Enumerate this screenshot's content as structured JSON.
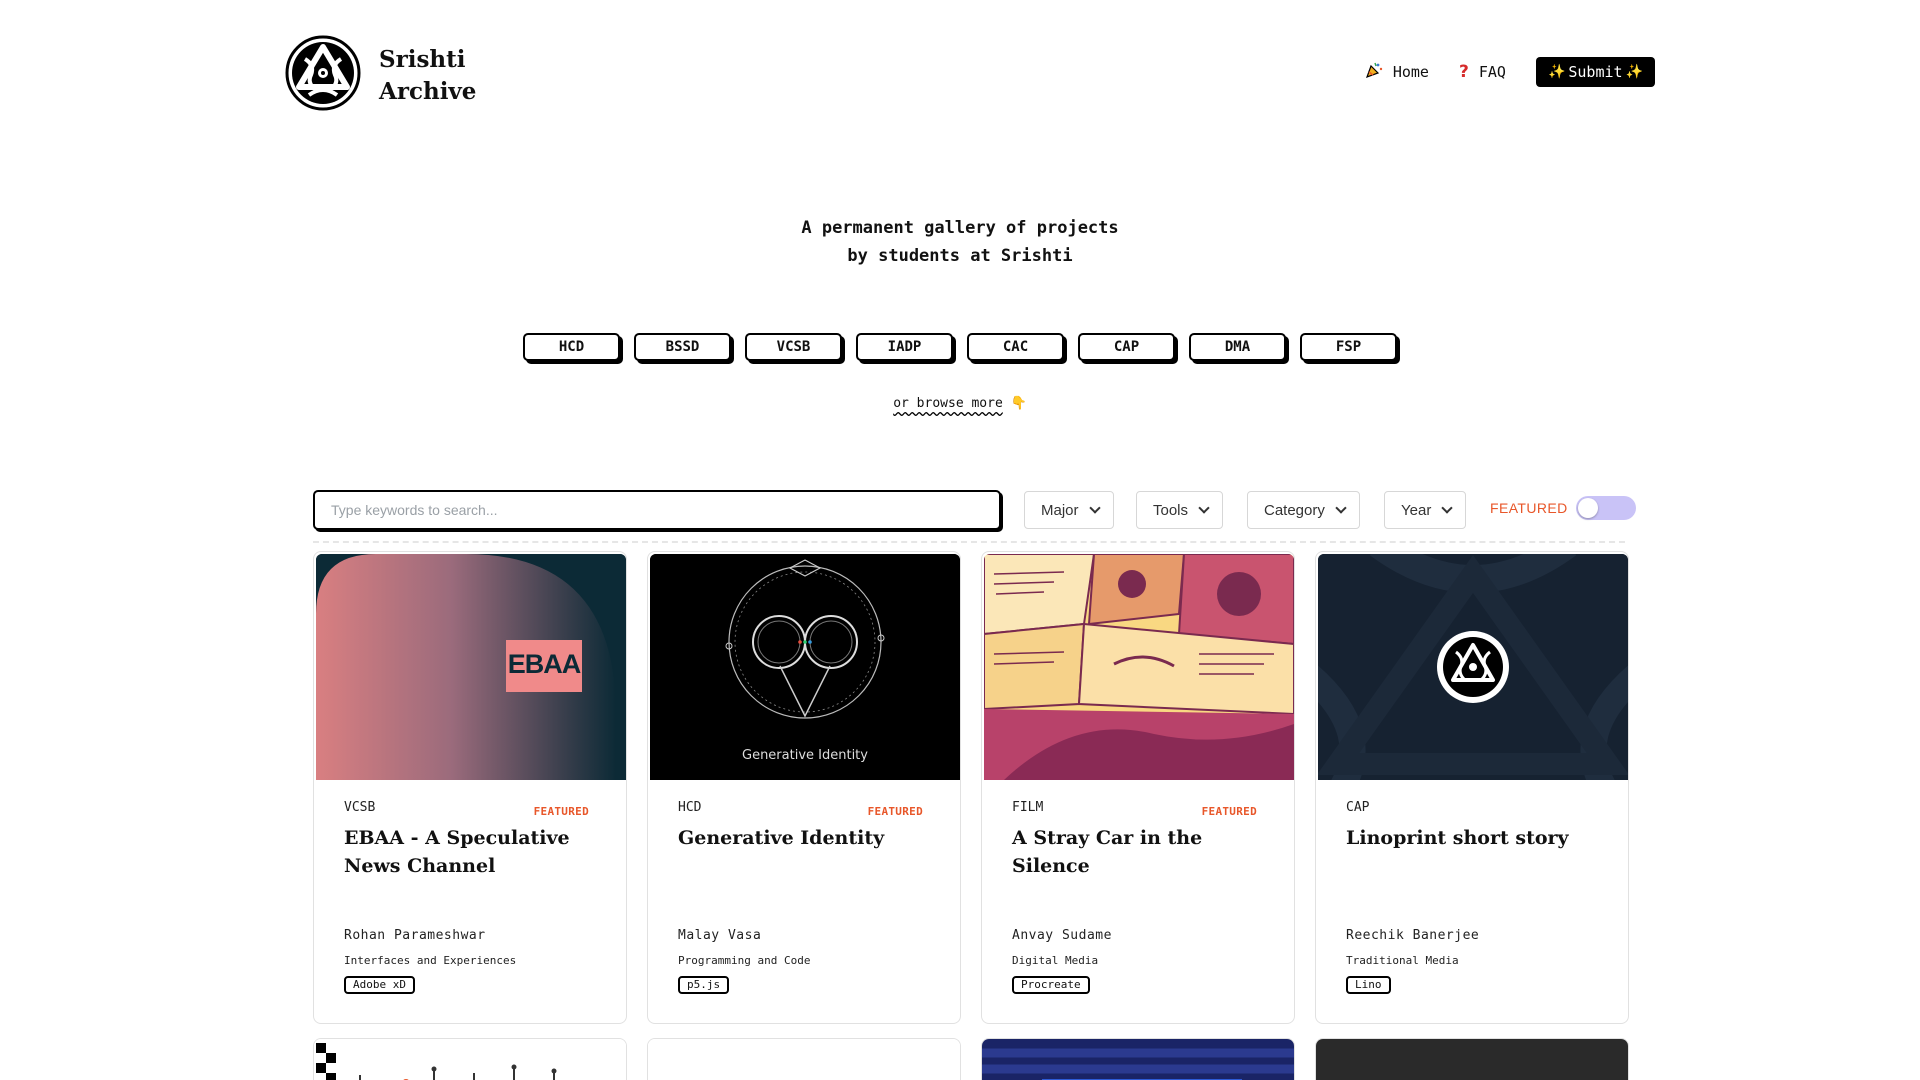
{
  "header": {
    "brand_line1": "Srishti",
    "brand_line2": "Archive",
    "nav": {
      "home_label": "Home",
      "home_icon": "party-horn-icon",
      "faq_label": "FAQ",
      "faq_icon": "question-mark-icon",
      "submit_label": "Submit",
      "submit_icon": "sparkles-icon"
    }
  },
  "hero": {
    "tagline_line1": "A permanent gallery of projects",
    "tagline_line2": "by students at Srishti",
    "majors": [
      "HCD",
      "BSSD",
      "VCSB",
      "IADP",
      "CAC",
      "CAP",
      "DMA",
      "FSP"
    ],
    "browse_more": "or browse more",
    "browse_more_icon": "pointing-down-hand-icon"
  },
  "filters": {
    "search_placeholder": "Type keywords to search...",
    "major_label": "Major",
    "tools_label": "Tools",
    "category_label": "Category",
    "year_label": "Year",
    "featured_label": "FEATURED",
    "featured_on": false
  },
  "cards": [
    {
      "major": "VCSB",
      "featured": "FEATURED",
      "title": "EBAA - A Speculative News Channel",
      "author": "Rohan Parameshwar",
      "category": "Interfaces and Experiences",
      "tool": "Adobe xD",
      "image_text": "EBAA"
    },
    {
      "major": "HCD",
      "featured": "FEATURED",
      "title": "Generative Identity",
      "author": "Malay Vasa",
      "category": "Programming and Code",
      "tool": "p5.js",
      "image_text": "Generative Identity"
    },
    {
      "major": "FILM",
      "featured": "FEATURED",
      "title": "A Stray Car in the Silence",
      "author": "Anvay Sudame",
      "category": "Digital Media",
      "tool": "Procreate",
      "image_text": ""
    },
    {
      "major": "CAP",
      "featured": "",
      "title": "Linoprint short story",
      "author": "Reechik Banerjee",
      "category": "Traditional Media",
      "tool": "Lino",
      "image_text": ""
    }
  ],
  "colors": {
    "accent_orange": "#e8572a",
    "toggle_track": "#c9c3f7",
    "ink": "#000000"
  }
}
